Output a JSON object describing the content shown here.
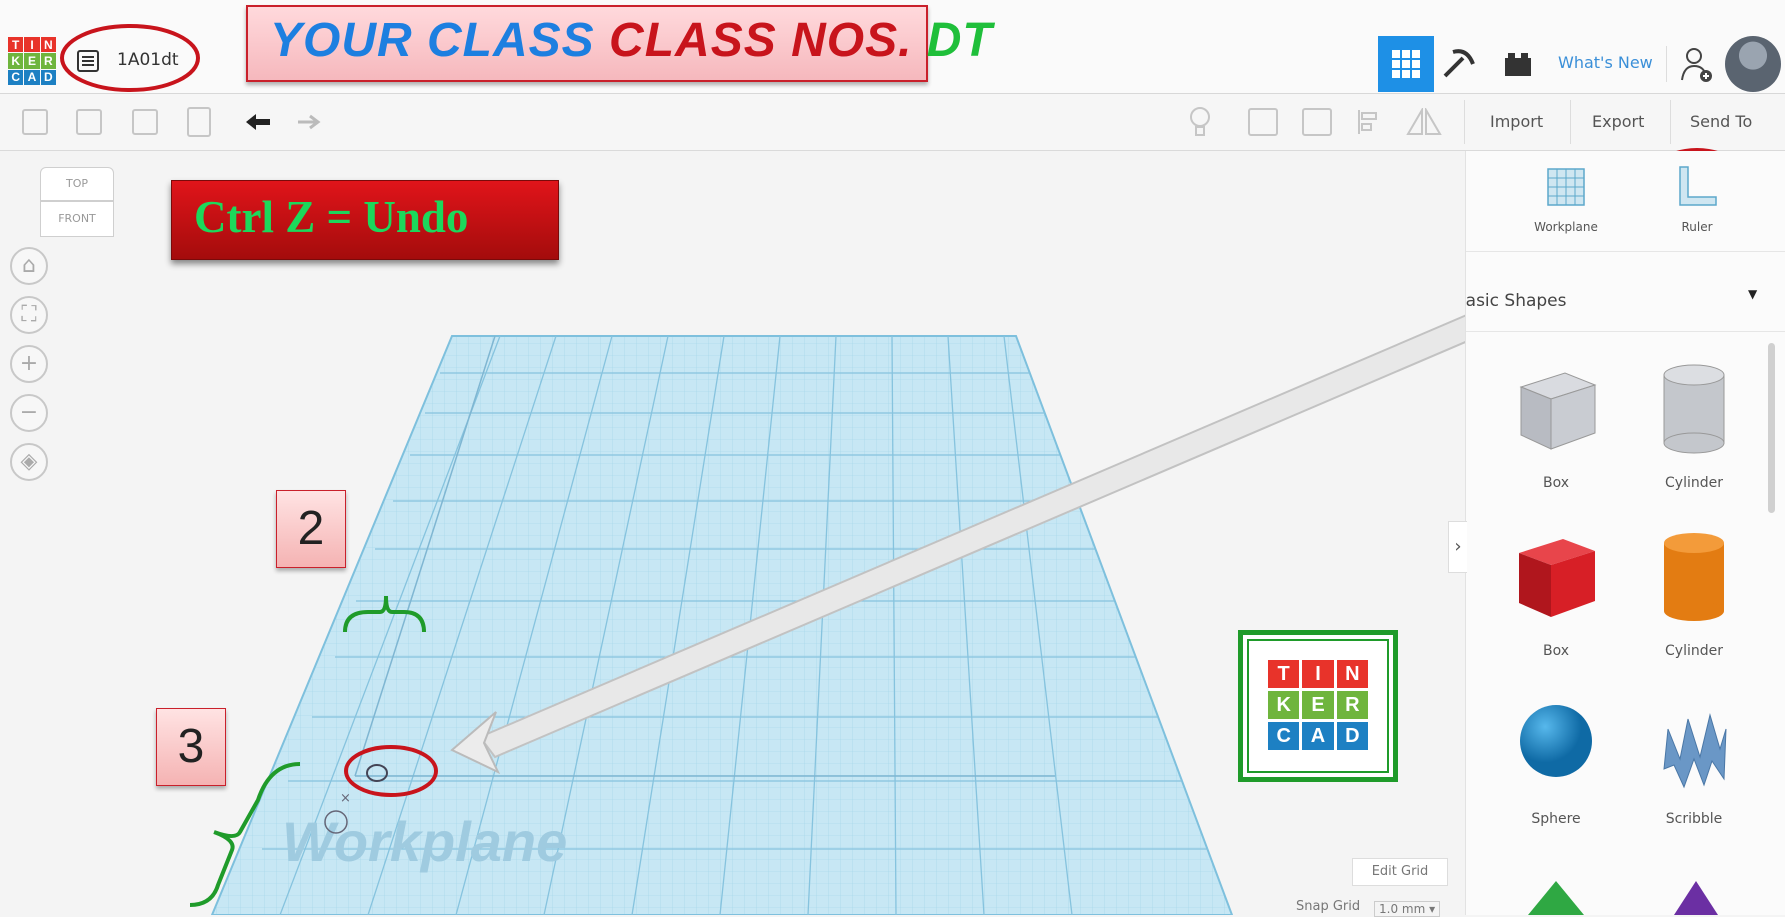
{
  "header": {
    "logo_letters": [
      "T",
      "I",
      "N",
      "K",
      "E",
      "R",
      "C",
      "A",
      "D"
    ],
    "logo_colors": [
      "#e8332a",
      "#e8332a",
      "#e8332a",
      "#6fb53d",
      "#6fb53d",
      "#6fb53d",
      "#1d80c3",
      "#1d80c3",
      "#1d80c3"
    ],
    "design_name": "1A01dt",
    "whats_new": "What's New",
    "icons": [
      "list-icon",
      "grid-view-icon",
      "pickaxe-icon",
      "brick-icon",
      "add-user-icon",
      "avatar"
    ]
  },
  "banner": {
    "part1": "YOUR CLASS",
    "part2": "CLASS NOS.",
    "part3": "DT",
    "colors": {
      "part1": "#1d7fe0",
      "part2": "#c8141c",
      "part3": "#1fbf3a"
    }
  },
  "toolbar": {
    "import_label": "Import",
    "export_label": "Export",
    "send_to_label": "Send To"
  },
  "viewcube": {
    "top": "TOP",
    "front": "FRONT"
  },
  "annotations": {
    "undo": "Ctrl Z = Undo",
    "box2": "2",
    "box3": "3"
  },
  "workplane": {
    "watermark": "Workplane",
    "edit_grid": "Edit Grid",
    "snap_grid": "Snap Grid",
    "snap_value": "1.0 mm ▾"
  },
  "panel": {
    "workplane_label": "Workplane",
    "ruler_label": "Ruler",
    "category": "Basic Shapes",
    "shapes": [
      {
        "label": "Box",
        "color": "#b9bcc3"
      },
      {
        "label": "Cylinder",
        "color": "#c4c7cc"
      },
      {
        "label": "Box",
        "color": "#d71f26"
      },
      {
        "label": "Cylinder",
        "color": "#e37c12"
      },
      {
        "label": "Sphere",
        "color": "#1b8fd2"
      },
      {
        "label": "Scribble",
        "color": "#6a97c6"
      }
    ]
  },
  "colors": {
    "accent": "#1e90e6",
    "highlight_red": "#c8141c",
    "bracket_green": "#1f9b2a"
  }
}
